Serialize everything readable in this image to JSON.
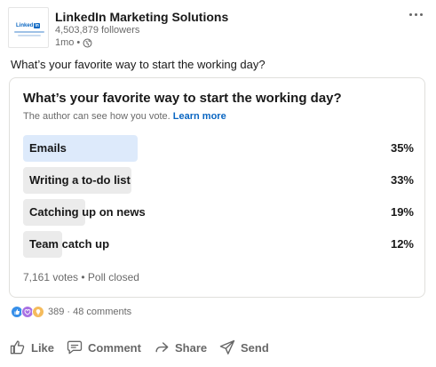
{
  "post": {
    "author": {
      "name": "LinkedIn Marketing Solutions",
      "followers": "4,503,879 followers",
      "time": "1mo",
      "logo_text": "Linked"
    },
    "text": "What’s your favorite way to start the working day?"
  },
  "poll": {
    "question": "What’s your favorite way to start the working day?",
    "note": "The author can see how you vote.",
    "learn_more": "Learn more",
    "options": [
      {
        "label": "Emails",
        "percent": "35%",
        "value": 0.35,
        "selected": true
      },
      {
        "label": "Writing a to-do list",
        "percent": "33%",
        "value": 0.33,
        "selected": false
      },
      {
        "label": "Catching up on news",
        "percent": "19%",
        "value": 0.19,
        "selected": false
      },
      {
        "label": "Team catch up",
        "percent": "12%",
        "value": 0.12,
        "selected": false
      }
    ],
    "footer": "7,161 votes • Poll closed"
  },
  "social": {
    "reactions": [
      "like-icon",
      "love-icon",
      "insightful-icon"
    ],
    "reaction_count": "389",
    "comments": "48 comments"
  },
  "actions": {
    "like": "Like",
    "comment": "Comment",
    "share": "Share",
    "send": "Send"
  },
  "colors": {
    "brand": "#0a66c2",
    "selected_bar": "#ddeafb",
    "bar": "#ebebeb"
  }
}
